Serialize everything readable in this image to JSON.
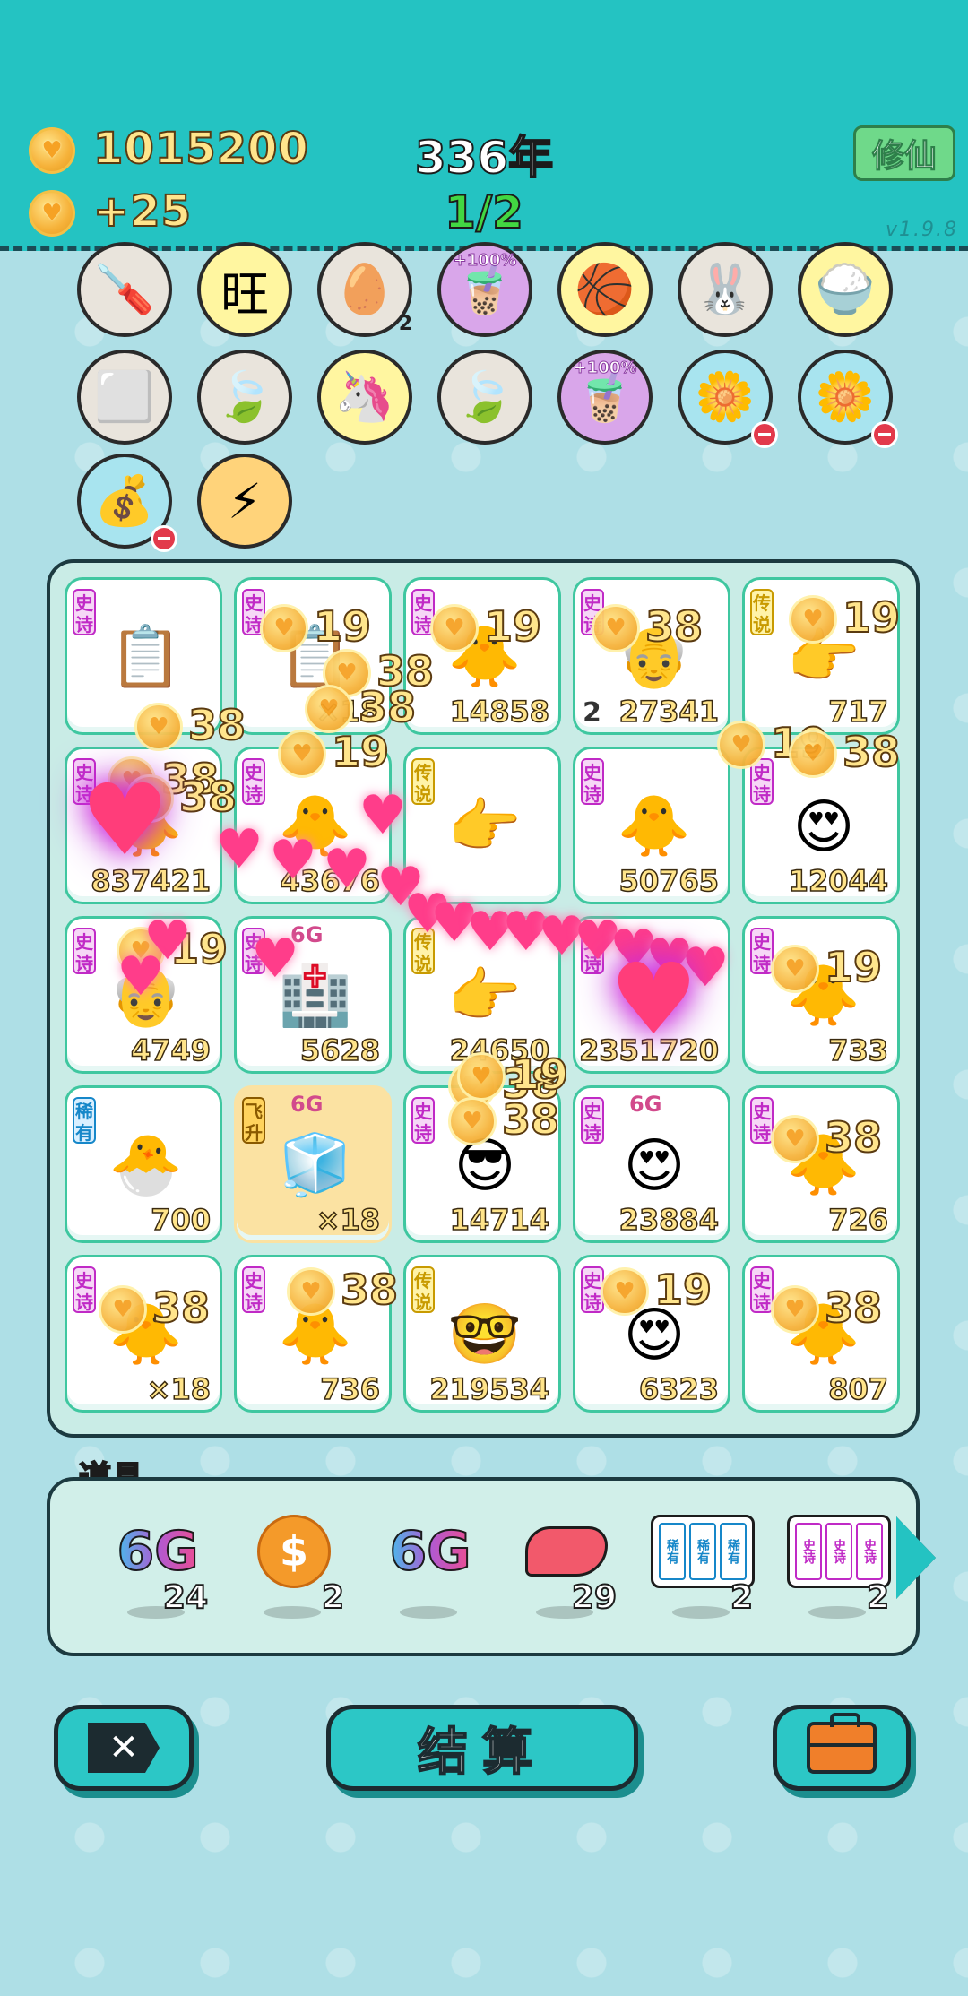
{
  "header": {
    "gold": "1015200",
    "income": "+25",
    "year": "336年",
    "progress": "1/2",
    "cultivate_label": "修仙",
    "version": "v1.9.8"
  },
  "buffs": {
    "row1": [
      {
        "icon": "screwdriver-icon",
        "glyph": "🪛",
        "bg": "#e9e4dc"
      },
      {
        "icon": "wang-snack-icon",
        "glyph": "旺",
        "bg": "#fff6a0"
      },
      {
        "icon": "egg-tray-icon",
        "glyph": "🥚",
        "bg": "#e9e4dc",
        "badge": "2"
      },
      {
        "icon": "milk-tea-icon",
        "glyph": "🧋",
        "bg": "#d9a6ea",
        "note": "+100%"
      },
      {
        "icon": "basketball-icon",
        "glyph": "🏀",
        "bg": "#fff6a0"
      },
      {
        "icon": "rabbit-icon",
        "glyph": "🐰",
        "bg": "#e9e4dc"
      },
      {
        "icon": "rice-bowl-icon",
        "glyph": "🍚",
        "bg": "#fff6a0"
      }
    ],
    "row2": [
      {
        "icon": "sugar-cubes-icon",
        "glyph": "⬜",
        "bg": "#e9e4dc"
      },
      {
        "icon": "leaf-icon",
        "glyph": "🍃",
        "bg": "#e9e4dc"
      },
      {
        "icon": "unicorn-icon",
        "glyph": "🦄",
        "bg": "#fff6a0"
      },
      {
        "icon": "leaf-icon",
        "glyph": "🍃",
        "bg": "#e9e4dc"
      },
      {
        "icon": "milk-tea-icon",
        "glyph": "🧋",
        "bg": "#d9a6ea",
        "note": "+100%"
      },
      {
        "icon": "flower-pot-icon",
        "glyph": "🌼",
        "bg": "#a8e4ef",
        "minus": true
      },
      {
        "icon": "flower-pot-icon",
        "glyph": "🌼",
        "bg": "#a8e4ef",
        "minus": true
      }
    ],
    "row3": [
      {
        "icon": "sack-icon",
        "glyph": "💰",
        "bg": "#a8e4ef",
        "minus": true
      },
      {
        "icon": "lightning-icon",
        "glyph": "⚡",
        "bg": "#ffd37a"
      }
    ]
  },
  "board": {
    "rows": [
      [
        {
          "tag": "史诗",
          "kind": "epic",
          "icon": "ctrl-c-v-card-icon",
          "glyph": "📋",
          "value": ""
        },
        {
          "tag": "史诗",
          "kind": "epic",
          "icon": "ctrl-c-v-card-icon",
          "glyph": "📋",
          "value": "×18"
        },
        {
          "tag": "史诗",
          "kind": "epic",
          "icon": "chick-face-icon",
          "glyph": "🐥",
          "value": "14858"
        },
        {
          "tag": "史诗",
          "kind": "epic",
          "icon": "old-man-face-icon",
          "glyph": "👴",
          "value": "27341",
          "left": "2"
        },
        {
          "tag": "传说",
          "kind": "leg",
          "icon": "pointing-hand-icon",
          "glyph": "👉",
          "value": "717"
        }
      ],
      [
        {
          "tag": "史诗",
          "kind": "epic",
          "icon": "chick-face-icon",
          "glyph": "🐥",
          "value": "837421"
        },
        {
          "tag": "史诗",
          "kind": "epic",
          "icon": "chick-face-icon",
          "glyph": "🐥",
          "value": "43676"
        },
        {
          "tag": "传说",
          "kind": "leg",
          "icon": "pointing-hand-icon",
          "glyph": "👉",
          "value": ""
        },
        {
          "tag": "史诗",
          "kind": "epic",
          "icon": "chick-face-icon",
          "glyph": "🐥",
          "value": "50765"
        },
        {
          "tag": "史诗",
          "kind": "epic",
          "icon": "green-hat-face-icon",
          "glyph": "😍",
          "value": "12044"
        }
      ],
      [
        {
          "tag": "史诗",
          "kind": "epic",
          "icon": "old-man-face-icon",
          "glyph": "👴",
          "value": "4749"
        },
        {
          "tag": "史诗",
          "kind": "epic",
          "icon": "icu-card-icon",
          "glyph": "🏥",
          "value": "5628",
          "sixg": "6G"
        },
        {
          "tag": "传说",
          "kind": "leg",
          "icon": "pointing-hand-icon",
          "glyph": "👉",
          "value": "24650"
        },
        {
          "tag": "史诗",
          "kind": "epic",
          "icon": "heart-burst-icon",
          "glyph": "💗",
          "value": "2351720"
        },
        {
          "tag": "史诗",
          "kind": "epic",
          "icon": "chick-face-icon",
          "glyph": "🐥",
          "value": "733"
        }
      ],
      [
        {
          "tag": "稀有",
          "kind": "rare",
          "icon": "chick-icon",
          "glyph": "🐣",
          "value": "700"
        },
        {
          "tag": "飞升",
          "kind": "fly",
          "icon": "fridge-icon",
          "glyph": "🧊",
          "value": "×18",
          "sixg": "6G",
          "hl": true
        },
        {
          "tag": "史诗",
          "kind": "epic",
          "icon": "sunglasses-face-icon",
          "glyph": "😎",
          "value": "14714"
        },
        {
          "tag": "史诗",
          "kind": "epic",
          "icon": "green-hat-face-icon",
          "glyph": "😍",
          "value": "23884",
          "sixg": "6G"
        },
        {
          "tag": "史诗",
          "kind": "epic",
          "icon": "chick-face-icon",
          "glyph": "🐥",
          "value": "726"
        }
      ],
      [
        {
          "tag": "史诗",
          "kind": "epic",
          "icon": "chick-face-icon",
          "glyph": "🐥",
          "value": "×18"
        },
        {
          "tag": "史诗",
          "kind": "epic",
          "icon": "chick-face-icon",
          "glyph": "🐥",
          "value": "736"
        },
        {
          "tag": "传说",
          "kind": "leg",
          "icon": "bald-glasses-face-icon",
          "glyph": "🤓",
          "value": "219534"
        },
        {
          "tag": "史诗",
          "kind": "epic",
          "icon": "green-hat-face-icon",
          "glyph": "😍",
          "value": "6323"
        },
        {
          "tag": "史诗",
          "kind": "epic",
          "icon": "chick-face-icon",
          "glyph": "🐥",
          "value": "807"
        }
      ]
    ]
  },
  "floating_numbers": [
    "19",
    "38",
    "19",
    "38",
    "19",
    "38",
    "38",
    "19",
    "38",
    "19",
    "38",
    "19",
    "19",
    "38",
    "38",
    "38",
    "38",
    "19",
    "19",
    "38",
    "38",
    "38"
  ],
  "tools": {
    "title": "道具",
    "items": [
      {
        "icon": "6g-icon",
        "label": "6G",
        "count": "24"
      },
      {
        "icon": "dollar-coin-icon",
        "label": "$",
        "count": "2"
      },
      {
        "icon": "6g-icon",
        "label": "6G",
        "count": ""
      },
      {
        "icon": "liver-icon",
        "label": "",
        "count": "29"
      },
      {
        "icon": "rare-card-pack-icon",
        "label": "稀有",
        "count": "2"
      },
      {
        "icon": "epic-card-pack-icon",
        "label": "史诗",
        "count": "2"
      }
    ]
  },
  "bottom": {
    "settle_label": "结算"
  },
  "colors": {
    "topbar": "#24c3c2",
    "background": "#aedfe6",
    "gold_text": "#ffe58c",
    "epic": "#c02ac6",
    "legend": "#c89a00",
    "rare": "#1687c9"
  }
}
